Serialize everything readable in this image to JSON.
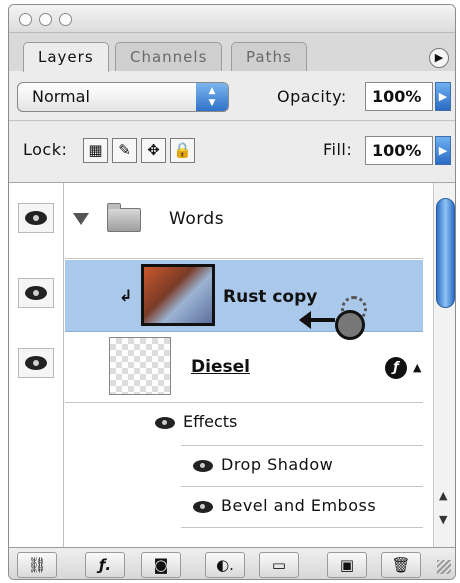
{
  "tabs": [
    "Layers",
    "Channels",
    "Paths"
  ],
  "options": {
    "blend_mode": "Normal",
    "opacity_label": "Opacity:",
    "opacity_value": "100%",
    "lock_label": "Lock:",
    "fill_label": "Fill:",
    "fill_value": "100%"
  },
  "layers": {
    "group_name": "Words",
    "rust_name": "Rust copy",
    "diesel_name": "Diesel",
    "effects_label": "Effects",
    "effect_1": "Drop Shadow",
    "effect_2": "Bevel and Emboss"
  },
  "colors": {
    "selection": "#aac8ea",
    "accent": "#2f72c9"
  },
  "icons": {
    "visibility": "eye-icon",
    "group_folder": "folder-icon",
    "effects": "fx-icon",
    "cursor": "clipping-cursor-icon"
  }
}
